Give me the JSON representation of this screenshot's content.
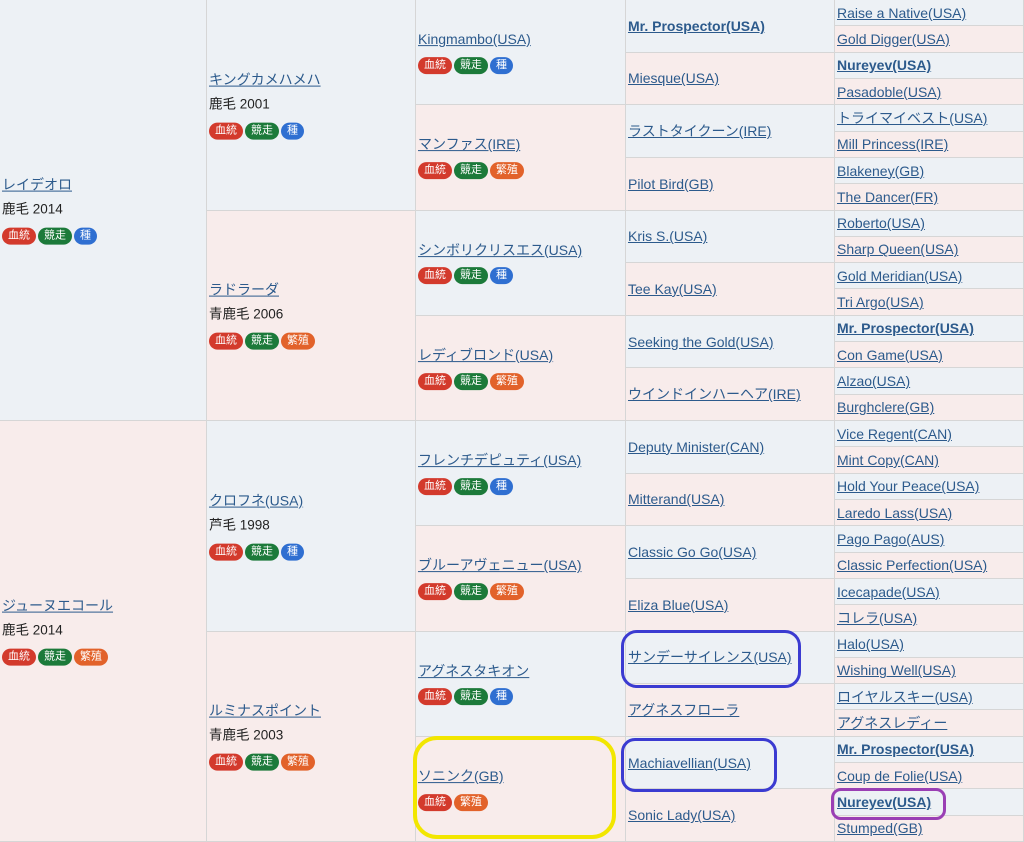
{
  "badge_labels": {
    "blood": "血統",
    "race": "競走",
    "sire": "種",
    "broodmare": "繁殖"
  },
  "colors": {
    "male_bg": "#edf1f5",
    "female_bg": "#f8eceb",
    "link": "#2c5a8c",
    "highlight_blue": "#3b3bd1",
    "highlight_yellow": "#f2e600",
    "highlight_purple": "#9a3fb4"
  },
  "gen1": [
    {
      "name": "レイデオロ",
      "info": "鹿毛 2014",
      "badges": [
        "blood",
        "race",
        "sire"
      ],
      "sex": "m"
    },
    {
      "name": "ジューヌエコール",
      "info": "鹿毛 2014",
      "badges": [
        "blood",
        "race",
        "broodmare"
      ],
      "sex": "f"
    }
  ],
  "gen2": [
    {
      "name": "キングカメハメハ",
      "info": "鹿毛 2001",
      "badges": [
        "blood",
        "race",
        "sire"
      ],
      "sex": "m"
    },
    {
      "name": "ラドラーダ",
      "info": "青鹿毛 2006",
      "badges": [
        "blood",
        "race",
        "broodmare"
      ],
      "sex": "f"
    },
    {
      "name": "クロフネ(USA)",
      "info": "芦毛 1998",
      "badges": [
        "blood",
        "race",
        "sire"
      ],
      "sex": "m"
    },
    {
      "name": "ルミナスポイント",
      "info": "青鹿毛 2003",
      "badges": [
        "blood",
        "race",
        "broodmare"
      ],
      "sex": "f"
    }
  ],
  "gen3": [
    {
      "name": "Kingmambo(USA)",
      "badges": [
        "blood",
        "race",
        "sire"
      ],
      "sex": "m"
    },
    {
      "name": "マンファス(IRE)",
      "badges": [
        "blood",
        "race",
        "broodmare"
      ],
      "sex": "f"
    },
    {
      "name": "シンボリクリスエス(USA)",
      "badges": [
        "blood",
        "race",
        "sire"
      ],
      "sex": "m"
    },
    {
      "name": "レディブロンド(USA)",
      "badges": [
        "blood",
        "race",
        "broodmare"
      ],
      "sex": "f"
    },
    {
      "name": "フレンチデピュティ(USA)",
      "badges": [
        "blood",
        "race",
        "sire"
      ],
      "sex": "m"
    },
    {
      "name": "ブルーアヴェニュー(USA)",
      "badges": [
        "blood",
        "race",
        "broodmare"
      ],
      "sex": "f"
    },
    {
      "name": "アグネスタキオン",
      "badges": [
        "blood",
        "race",
        "sire"
      ],
      "sex": "m"
    },
    {
      "name": "ソニンク(GB)",
      "badges": [
        "blood",
        "broodmare"
      ],
      "sex": "f"
    }
  ],
  "gen4": [
    {
      "name": "Mr. Prospector(USA)",
      "bold": true,
      "sex": "m"
    },
    {
      "name": "Miesque(USA)",
      "sex": "f"
    },
    {
      "name": "ラストタイクーン(IRE)",
      "sex": "m"
    },
    {
      "name": "Pilot Bird(GB)",
      "sex": "f"
    },
    {
      "name": "Kris S.(USA)",
      "sex": "m"
    },
    {
      "name": "Tee Kay(USA)",
      "sex": "f"
    },
    {
      "name": "Seeking the Gold(USA)",
      "sex": "m"
    },
    {
      "name": "ウインドインハーヘア(IRE)",
      "sex": "f"
    },
    {
      "name": "Deputy Minister(CAN)",
      "sex": "m"
    },
    {
      "name": "Mitterand(USA)",
      "sex": "f"
    },
    {
      "name": "Classic Go Go(USA)",
      "sex": "m"
    },
    {
      "name": "Eliza Blue(USA)",
      "sex": "f"
    },
    {
      "name": "サンデーサイレンス(USA)",
      "sex": "m"
    },
    {
      "name": "アグネスフローラ",
      "sex": "f",
      "nolink": true
    },
    {
      "name": "Machiavellian(USA)",
      "sex": "m"
    },
    {
      "name": "Sonic Lady(USA)",
      "sex": "f"
    }
  ],
  "gen5": [
    {
      "name": "Raise a Native(USA)",
      "sex": "m"
    },
    {
      "name": "Gold Digger(USA)",
      "sex": "f"
    },
    {
      "name": "Nureyev(USA)",
      "bold": true,
      "sex": "m"
    },
    {
      "name": "Pasadoble(USA)",
      "sex": "f"
    },
    {
      "name": "トライマイベスト(USA)",
      "sex": "m"
    },
    {
      "name": "Mill Princess(IRE)",
      "sex": "f"
    },
    {
      "name": "Blakeney(GB)",
      "sex": "m"
    },
    {
      "name": "The Dancer(FR)",
      "sex": "f"
    },
    {
      "name": "Roberto(USA)",
      "sex": "m"
    },
    {
      "name": "Sharp Queen(USA)",
      "sex": "f"
    },
    {
      "name": "Gold Meridian(USA)",
      "sex": "m"
    },
    {
      "name": "Tri Argo(USA)",
      "sex": "f"
    },
    {
      "name": "Mr. Prospector(USA)",
      "bold": true,
      "sex": "m"
    },
    {
      "name": "Con Game(USA)",
      "sex": "f"
    },
    {
      "name": "Alzao(USA)",
      "sex": "m"
    },
    {
      "name": "Burghclere(GB)",
      "sex": "f"
    },
    {
      "name": "Vice Regent(CAN)",
      "sex": "m"
    },
    {
      "name": "Mint Copy(CAN)",
      "sex": "f"
    },
    {
      "name": "Hold Your Peace(USA)",
      "sex": "m"
    },
    {
      "name": "Laredo Lass(USA)",
      "sex": "f"
    },
    {
      "name": "Pago Pago(AUS)",
      "sex": "m"
    },
    {
      "name": "Classic Perfection(USA)",
      "sex": "f"
    },
    {
      "name": "Icecapade(USA)",
      "sex": "m"
    },
    {
      "name": "コレラ(USA)",
      "sex": "f"
    },
    {
      "name": "Halo(USA)",
      "sex": "m"
    },
    {
      "name": "Wishing Well(USA)",
      "sex": "f"
    },
    {
      "name": "ロイヤルスキー(USA)",
      "sex": "m"
    },
    {
      "name": "アグネスレディー",
      "sex": "f"
    },
    {
      "name": "Mr. Prospector(USA)",
      "bold": true,
      "sex": "m"
    },
    {
      "name": "Coup de Folie(USA)",
      "sex": "f"
    },
    {
      "name": "Nureyev(USA)",
      "bold": true,
      "sex": "m"
    },
    {
      "name": "Stumped(GB)",
      "sex": "f"
    }
  ]
}
